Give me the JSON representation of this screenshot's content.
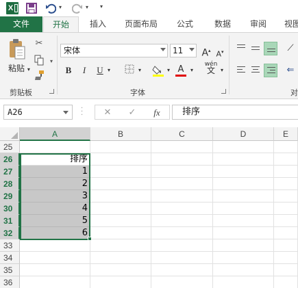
{
  "qat": {
    "app_icon": "excel-logo",
    "app_icon_letter": "X",
    "save_icon": "save-icon",
    "undo_icon": "undo-icon",
    "redo_icon": "redo-icon",
    "customize_icon": "customize-qat-icon"
  },
  "tabs": [
    "文件",
    "开始",
    "插入",
    "页面布局",
    "公式",
    "数据",
    "审阅",
    "视图"
  ],
  "ribbon": {
    "clipboard": {
      "paste_label": "粘贴",
      "group_label": "剪贴板"
    },
    "font": {
      "font_name": "宋体",
      "font_size": "11",
      "grow_label": "A",
      "shrink_label": "A",
      "bold": "B",
      "italic": "I",
      "underline": "U",
      "font_color_label": "A",
      "phonetic_label": "wén",
      "group_label": "字体"
    },
    "alignment": {
      "group_label": "对"
    }
  },
  "formula_bar": {
    "name_box": "A26",
    "cancel": "✕",
    "enter": "✓",
    "fx": "fx",
    "content": "排序"
  },
  "sheet": {
    "columns": [
      "A",
      "B",
      "C",
      "D",
      "E"
    ],
    "selected_column": "A",
    "rows": [
      "25",
      "26",
      "27",
      "28",
      "29",
      "30",
      "31",
      "32",
      "33",
      "34",
      "35",
      "36"
    ],
    "selected_rows": [
      "26",
      "27",
      "28",
      "29",
      "30",
      "31",
      "32"
    ],
    "column_a_values": [
      "",
      "排序",
      "1",
      "2",
      "3",
      "4",
      "5",
      "6",
      "",
      "",
      "",
      ""
    ],
    "selection_range": "A26:A32",
    "selection_color": "#217346",
    "shade_color": "#c8c8c8"
  },
  "colors": {
    "accent": "#217346",
    "ribbon_bg": "#f3f3f3"
  }
}
